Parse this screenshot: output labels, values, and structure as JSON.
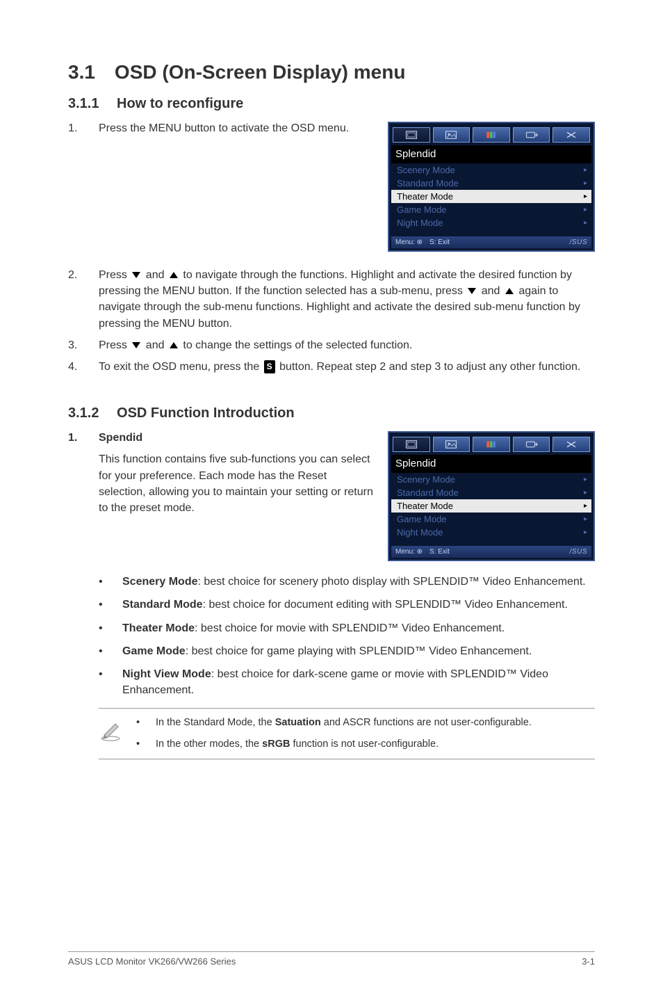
{
  "title": "3.1 OSD (On-Screen Display) menu",
  "sub1": {
    "heading": "3.1.1  How to reconfigure"
  },
  "steps1": {
    "s1_num": "1.",
    "s1": "Press the MENU button to activate the OSD menu."
  },
  "osd": {
    "header": "Splendid",
    "items": [
      {
        "label": "Scenery Mode",
        "hl": false
      },
      {
        "label": "Standard Mode",
        "hl": false
      },
      {
        "label": "Theater Mode",
        "hl": true
      },
      {
        "label": "Game Mode",
        "hl": false
      },
      {
        "label": "Night Mode",
        "hl": false
      }
    ],
    "nav_left": "Menu: ⊕ S: Exit",
    "brand": "/SUS"
  },
  "steps2": {
    "s2_num": "2.",
    "s2a": "Press ",
    "s2b": " and ",
    "s2c": " to navigate through the functions. Highlight and activate the desired function by pressing the MENU button. If the function selected has a sub-menu, press ",
    "s2d": " and ",
    "s2e": " again to navigate through the sub-menu functions. Highlight and activate the desired sub-menu function by pressing the MENU button.",
    "s3_num": "3.",
    "s3a": "Press ",
    "s3b": " and ",
    "s3c": " to change the settings of the selected function.",
    "s4_num": "4.",
    "s4a": "To exit the OSD menu, press the ",
    "s4_s": "S",
    "s4b": " button. Repeat step 2 and step 3 to adjust any other function."
  },
  "sub2": {
    "heading": "3.1.2  OSD Function Introduction"
  },
  "spendid": {
    "num": "1.",
    "title": "Spendid",
    "desc": "This function contains five sub-functions you can select for your preference. Each mode has the Reset selection, allowing you to maintain your setting or return to the preset mode."
  },
  "modes": {
    "scenery_b": "Scenery Mode",
    "scenery_t": ": best choice for scenery photo display with SPLENDID™ Video Enhancement.",
    "standard_b": "Standard Mode",
    "standard_t": ": best choice for document editing with SPLENDID™ Video Enhancement.",
    "theater_b": "Theater Mode",
    "theater_t": ": best choice for movie with SPLENDID™ Video Enhancement.",
    "game_b": "Game Mode",
    "game_t": ": best choice for game playing with SPLENDID™ Video Enhancement.",
    "night_b": "Night View Mode",
    "night_t": ": best choice for dark-scene game or movie with SPLENDID™ Video Enhancement."
  },
  "notes": {
    "n1a": "In the Standard Mode, the ",
    "n1b": "Satuation",
    "n1c": " and ASCR functions are not user-configurable.",
    "n2a": "In the other modes, the ",
    "n2b": "sRGB",
    "n2c": " function is not user-configurable."
  },
  "footer": {
    "left": "ASUS LCD Monitor VK266/VW266 Series",
    "right": "3-1"
  }
}
